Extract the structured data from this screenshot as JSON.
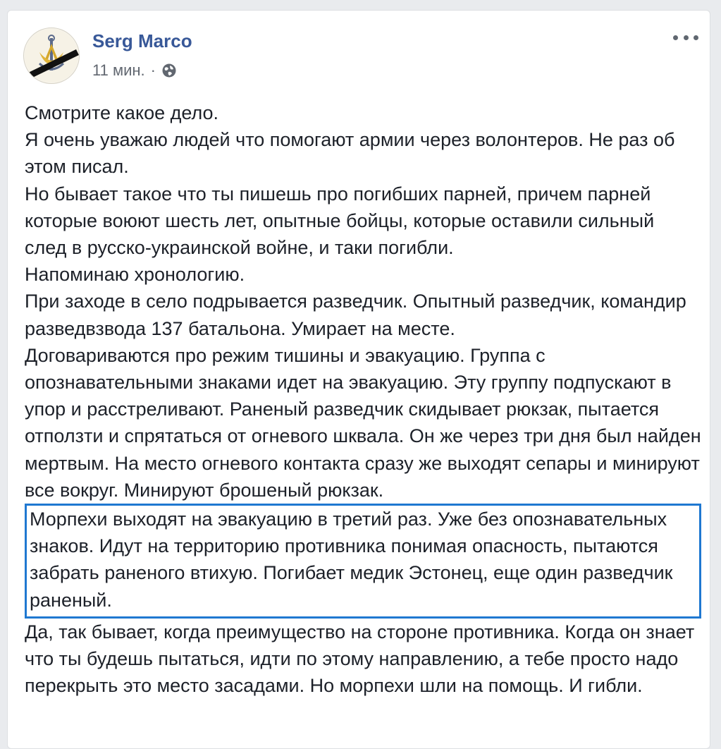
{
  "post": {
    "author": "Serg Marco",
    "time": "11 мин.",
    "separator": "·",
    "privacy_icon": "globe-icon",
    "more_icon": "more-options-icon",
    "paragraphs": [
      "Смотрите какое дело.\nЯ очень уважаю людей что помогают армии через волонтеров. Не раз об этом писал.\nНо бывает такое что ты пишешь про погибших парней, причем парней которые воюют шесть лет, опытные бойцы, которые оставили сильный след в русско-украинской войне, и таки погибли.\nНапоминаю хронологию.\nПри заходе в село подрывается разведчик. Опытный разведчик, командир разведвзвода 137 батальона. Умирает на месте.\nДоговариваются про режим тишины и эвакуацию. Группа с опознавательными знаками идет на эвакуацию. Эту группу подпускают в упор и расстреливают. Раненый разведчик скидывает рюкзак, пытается отползти и спрятаться от огневого шквала. Он же через три дня был найден мертвым. На место огневого контакта сразу же выходят сепары и минируют все вокруг. Минируют брошеный рюкзак.",
      "Морпехи выходят на эвакуацию в третий раз. Уже без опознавательных знаков. Идут на территорию противника понимая опасность, пытаются забрать раненого втихую. Погибает медик Эстонец, еще один разведчик раненый.",
      "Да, так бывает, когда преимущество на стороне противника. Когда он знает что ты будешь пытаться, идти по этому направлению, а тебе просто надо перекрыть это место засадами. Но морпехи шли на помощь. И гибли."
    ]
  },
  "colors": {
    "author_link": "#385898",
    "highlight_border": "#1f78d1",
    "body_text": "#1d2129",
    "meta_text": "#616770"
  }
}
